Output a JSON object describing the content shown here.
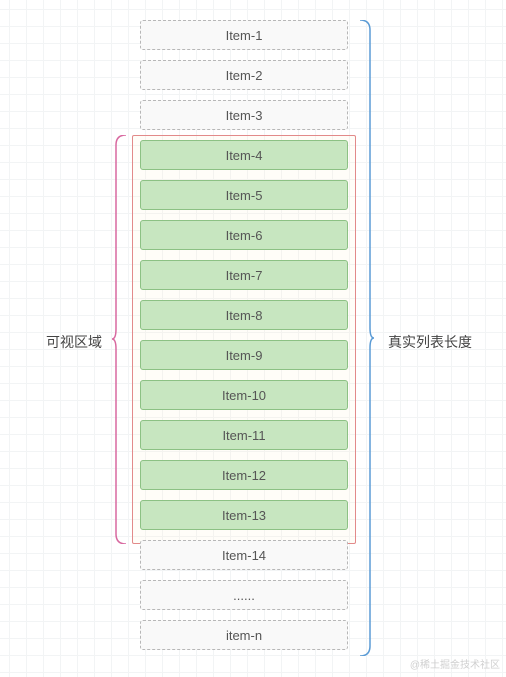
{
  "labels": {
    "visible_area": "可视区域",
    "real_list_length": "真实列表长度"
  },
  "top_items": [
    "Item-1",
    "Item-2",
    "Item-3"
  ],
  "visible_items": [
    "Item-4",
    "Item-5",
    "Item-6",
    "Item-7",
    "Item-8",
    "Item-9",
    "Item-10",
    "Item-11",
    "Item-12",
    "Item-13"
  ],
  "bottom_items": [
    "Item-14",
    "......",
    "item-n"
  ],
  "colors": {
    "viewport_border": "#e28a8a",
    "item_visible_bg": "#c7e6c0",
    "item_visible_border": "#8cc184",
    "item_dashed_border": "#b7b7b7",
    "bracket_left": "#d869a0",
    "bracket_right": "#5b9bd5"
  },
  "watermark": "@稀土掘金技术社区"
}
